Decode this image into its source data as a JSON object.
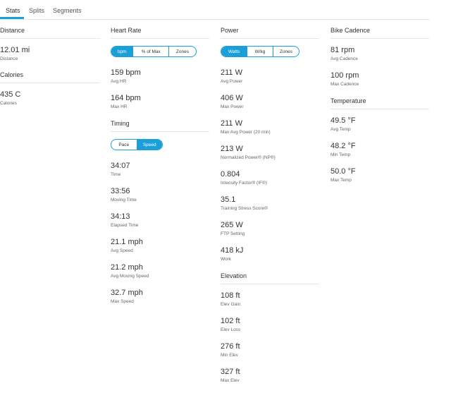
{
  "tabs": [
    {
      "label": "Stats"
    },
    {
      "label": "Splits"
    },
    {
      "label": "Segments"
    }
  ],
  "distance": {
    "title": "Distance",
    "stats": [
      {
        "value": "12.01 mi",
        "label": "Distance"
      }
    ]
  },
  "calories": {
    "title": "Calories",
    "stats": [
      {
        "value": "435 C",
        "label": "Calories"
      }
    ]
  },
  "heart_rate": {
    "title": "Heart Rate",
    "toggle": [
      "bpm",
      "% of Max",
      "Zones"
    ],
    "stats": [
      {
        "value": "159 bpm",
        "label": "Avg HR"
      },
      {
        "value": "164 bpm",
        "label": "Max HR"
      }
    ]
  },
  "timing": {
    "title": "Timing",
    "toggle": [
      "Pace",
      "Speed"
    ],
    "stats": [
      {
        "value": "34:07",
        "label": "Time"
      },
      {
        "value": "33:56",
        "label": "Moving Time"
      },
      {
        "value": "34:13",
        "label": "Elapsed Time"
      },
      {
        "value": "21.1 mph",
        "label": "Avg Speed"
      },
      {
        "value": "21.2 mph",
        "label": "Avg Moving Speed"
      },
      {
        "value": "32.7 mph",
        "label": "Max Speed"
      }
    ]
  },
  "power": {
    "title": "Power",
    "toggle": [
      "Watts",
      "W/kg",
      "Zones"
    ],
    "stats": [
      {
        "value": "211 W",
        "label": "Avg Power"
      },
      {
        "value": "406 W",
        "label": "Max Power"
      },
      {
        "value": "211 W",
        "label": "Max Avg Power (20 min)"
      },
      {
        "value": "213 W",
        "label": "Normalized Power® (NP®)"
      },
      {
        "value": "0.804",
        "label": "Intensity Factor® (IF®)"
      },
      {
        "value": "35.1",
        "label": "Training Stress Score®"
      },
      {
        "value": "265 W",
        "label": "FTP Setting"
      },
      {
        "value": "418 kJ",
        "label": "Work"
      }
    ]
  },
  "elevation": {
    "title": "Elevation",
    "stats": [
      {
        "value": "108 ft",
        "label": "Elev Gain"
      },
      {
        "value": "102 ft",
        "label": "Elev Loss"
      },
      {
        "value": "276 ft",
        "label": "Min Elev"
      },
      {
        "value": "327 ft",
        "label": "Max Elev"
      }
    ]
  },
  "bike_cadence": {
    "title": "Bike Cadence",
    "stats": [
      {
        "value": "81 rpm",
        "label": "Avg Cadence"
      },
      {
        "value": "100 rpm",
        "label": "Max Cadence"
      }
    ]
  },
  "temperature": {
    "title": "Temperature",
    "stats": [
      {
        "value": "49.5 °F",
        "label": "Avg Temp"
      },
      {
        "value": "48.2 °F",
        "label": "Min Temp"
      },
      {
        "value": "50.0 °F",
        "label": "Max Temp"
      }
    ]
  },
  "colors": {
    "accent": "#1a9fd9"
  }
}
